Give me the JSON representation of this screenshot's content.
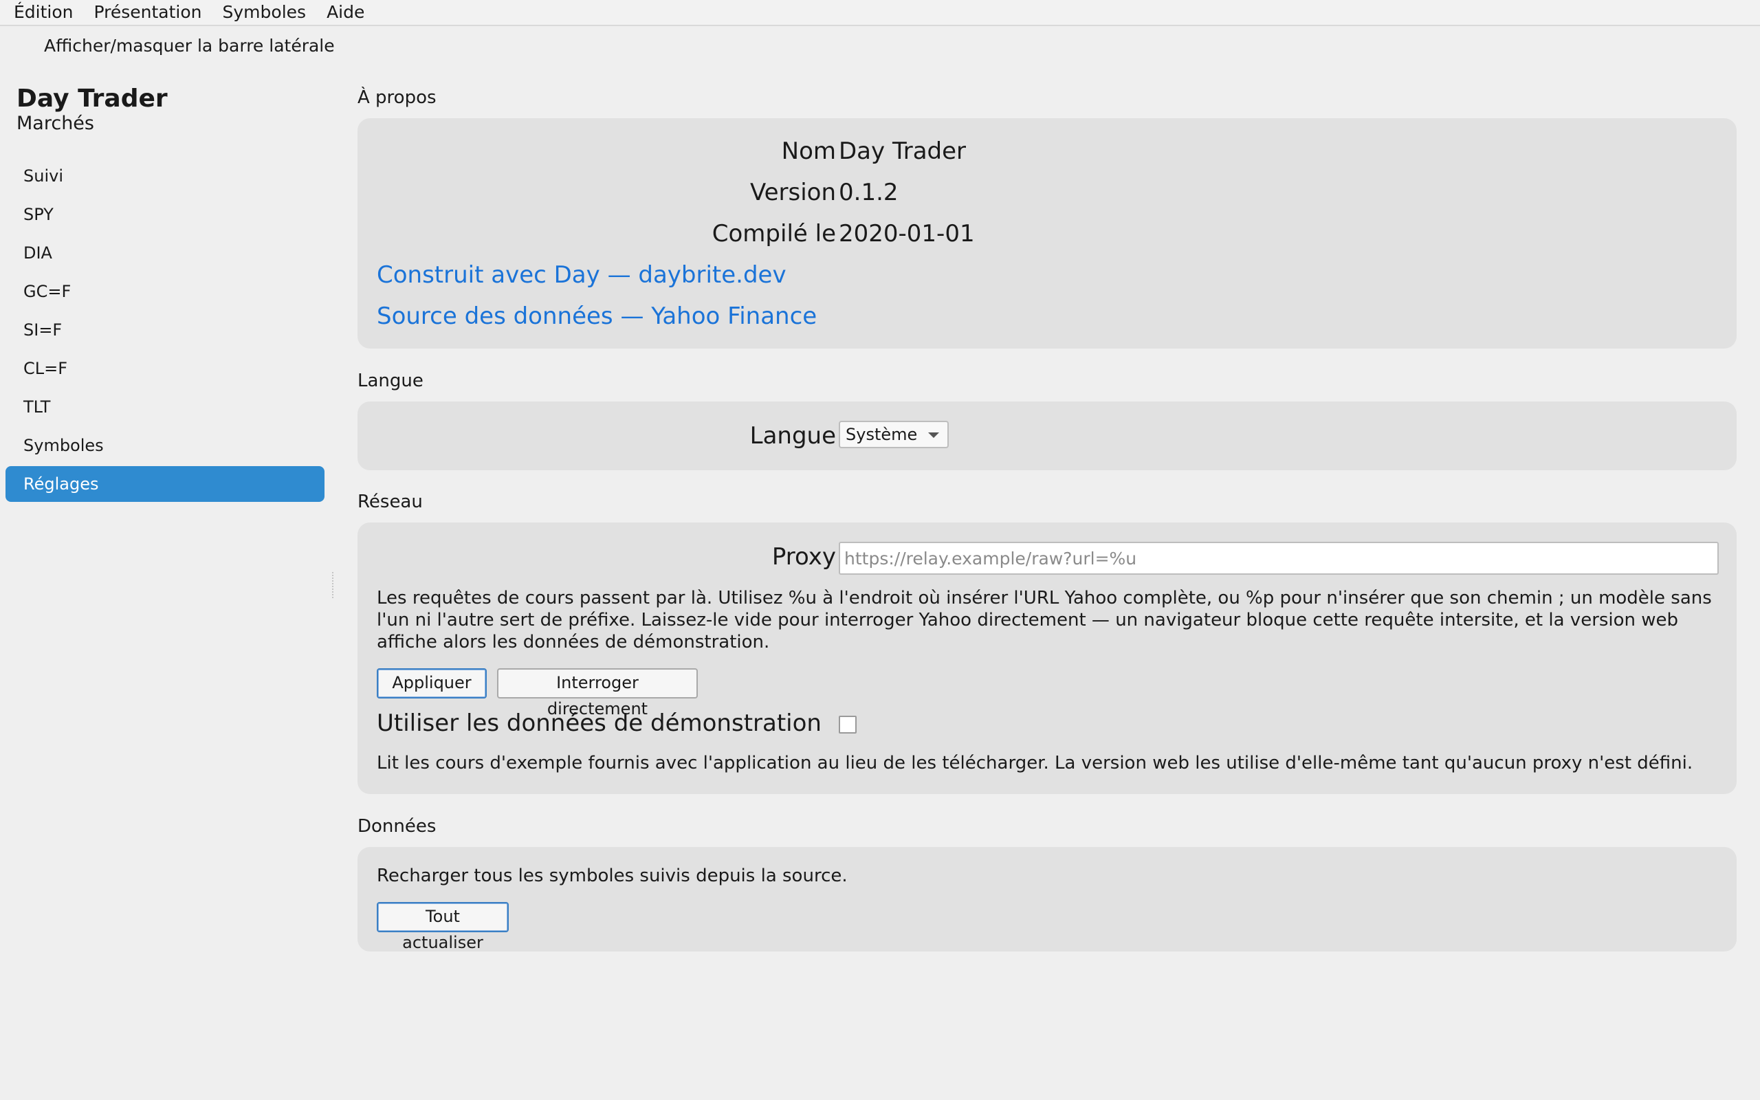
{
  "menubar": {
    "items": [
      "Édition",
      "Présentation",
      "Symboles",
      "Aide"
    ]
  },
  "toolbar": {
    "toggle_sidebar": "Afficher/masquer la barre latérale"
  },
  "sidebar": {
    "app_title": "Day Trader",
    "subtitle": "Marchés",
    "items": [
      {
        "label": "Suivi"
      },
      {
        "label": "SPY"
      },
      {
        "label": "DIA"
      },
      {
        "label": "GC=F"
      },
      {
        "label": "SI=F"
      },
      {
        "label": "CL=F"
      },
      {
        "label": "TLT"
      },
      {
        "label": "Symboles"
      },
      {
        "label": "Réglages",
        "active": true
      }
    ]
  },
  "about": {
    "heading": "À propos",
    "name_label": "Nom",
    "name_value": "Day Trader",
    "version_label": "Version",
    "version_value": "0.1.2",
    "build_label": "Compilé le",
    "build_value": "2020-01-01",
    "link_built_with": "Construit avec Day — daybrite.dev",
    "link_data_source": "Source des données — Yahoo Finance"
  },
  "language": {
    "heading": "Langue",
    "label": "Langue",
    "selected": "Système"
  },
  "network": {
    "heading": "Réseau",
    "proxy_label": "Proxy",
    "proxy_placeholder": "https://relay.example/raw?url=%u",
    "proxy_value": "",
    "help_line_1": "Les requêtes de cours passent par là. Utilisez %u à l'endroit où insérer l'URL Yahoo complète, ou %p pour n'insérer que son chemin ; un modèle sans",
    "help_line_2": "l'un ni l'autre sert de préfixe. Laissez-le vide pour interroger Yahoo directement — un navigateur bloque cette requête intersite, et la version web",
    "help_line_3": "affiche alors les données de démonstration.",
    "apply_button": "Appliquer",
    "direct_button": "Interroger directement",
    "demo_label": "Utiliser les données de démonstration",
    "demo_checked": false,
    "demo_help": "Lit les cours d'exemple fournis avec l'application au lieu de les télécharger. La version web les utilise d'elle-même tant qu'aucun proxy n'est défini."
  },
  "data_section": {
    "heading": "Données",
    "description": "Recharger tous les symboles suivis depuis la source.",
    "refresh_button": "Tout actualiser"
  },
  "colors": {
    "accent": "#2f8bd0",
    "link": "#1a73d8",
    "card_background": "#e1e1e1",
    "window_background": "#efefef"
  }
}
